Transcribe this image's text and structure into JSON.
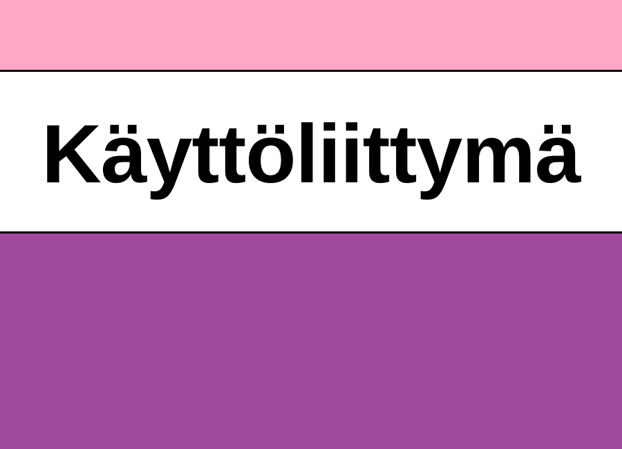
{
  "title": "Käyttöliittymä",
  "colors": {
    "top_band": "#ffa9c7",
    "bottom_band": "#a1489f",
    "middle_band": "#ffffff",
    "divider": "#000000",
    "text": "#000000"
  }
}
